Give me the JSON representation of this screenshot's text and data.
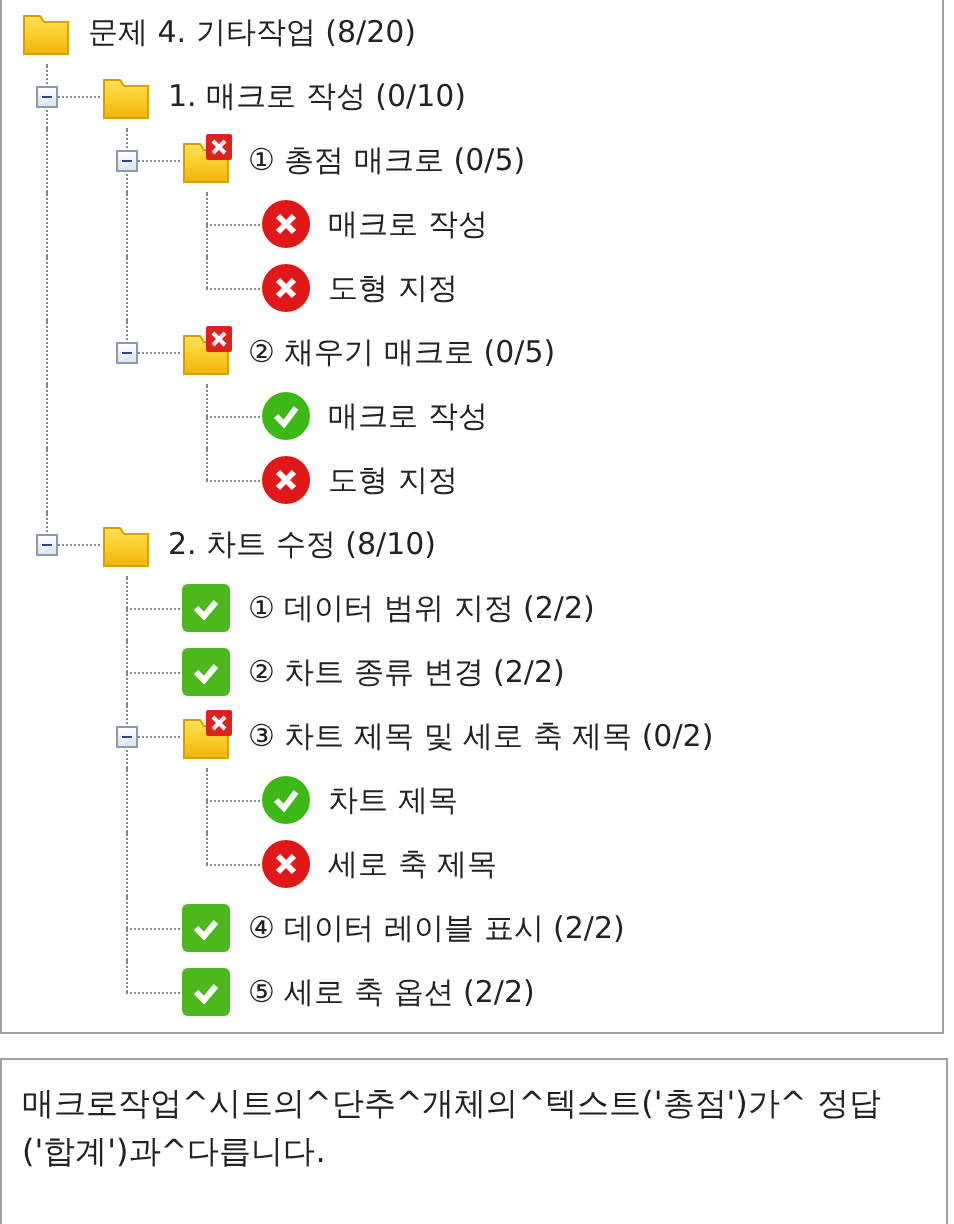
{
  "tree": {
    "label": "문제 4. 기타작업 (8/20)",
    "kind": "folder",
    "children": [
      {
        "label": "1. 매크로 작성 (0/10)",
        "kind": "folder",
        "expanded": true,
        "children": [
          {
            "label": "① 총점 매크로 (0/5)",
            "kind": "folder_fail",
            "expanded": true,
            "children": [
              {
                "label": "매크로 작성",
                "kind": "fail"
              },
              {
                "label": "도형 지정",
                "kind": "fail"
              }
            ]
          },
          {
            "label": "② 채우기 매크로 (0/5)",
            "kind": "folder_fail",
            "expanded": true,
            "children": [
              {
                "label": "매크로 작성",
                "kind": "pass"
              },
              {
                "label": "도형 지정",
                "kind": "fail"
              }
            ]
          }
        ]
      },
      {
        "label": "2. 차트 수정 (8/10)",
        "kind": "folder",
        "expanded": true,
        "children": [
          {
            "label": "① 데이터 범위 지정 (2/2)",
            "kind": "done"
          },
          {
            "label": "② 차트 종류 변경 (2/2)",
            "kind": "done"
          },
          {
            "label": "③ 차트 제목 및 세로 축 제목 (0/2)",
            "kind": "folder_fail",
            "expanded": true,
            "children": [
              {
                "label": "차트 제목",
                "kind": "pass"
              },
              {
                "label": "세로 축 제목",
                "kind": "fail"
              }
            ]
          },
          {
            "label": "④ 데이터 레이블 표시 (2/2)",
            "kind": "done"
          },
          {
            "label": "⑤ 세로 축 옵션 (2/2)",
            "kind": "done"
          }
        ]
      }
    ]
  },
  "message": {
    "text": "매크로작업^시트의^단추^개체의^텍스트('총점')가^ 정답('합계')과^다릅니다."
  }
}
